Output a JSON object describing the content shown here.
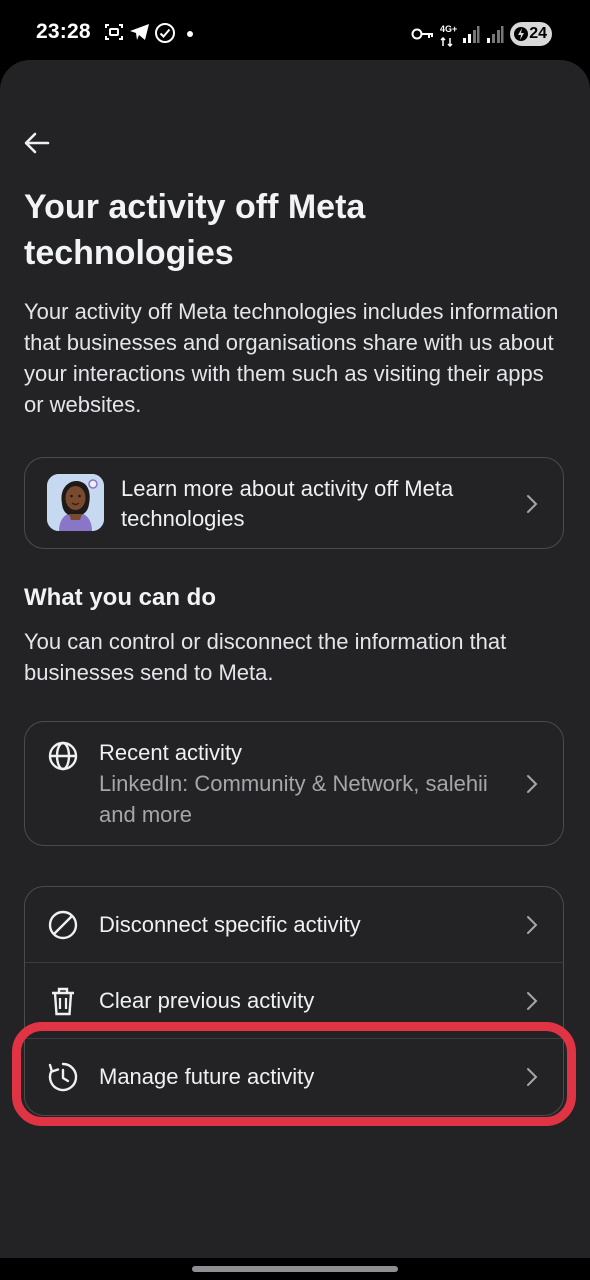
{
  "status_bar": {
    "time": "23:28",
    "network_label": "4G+",
    "battery": "24",
    "icons": [
      "screenshot-icon",
      "telegram-icon",
      "check-circle-icon",
      "dot-icon",
      "key-icon",
      "network-4g-icon",
      "signal-icon",
      "signal-icon-2",
      "battery-icon"
    ]
  },
  "header": {
    "back_icon": "arrow-left-icon",
    "title": "Your activity off Meta technologies",
    "description": "Your activity off Meta technologies includes information that businesses and organisations share with us about your interactions with them such as visiting their apps or websites."
  },
  "learn_more": {
    "label": "Learn more about activity off Meta technologies",
    "icon": "avatar-illustration"
  },
  "section": {
    "heading": "What you can do",
    "text": "You can control or disconnect the information that businesses send to Meta."
  },
  "recent_activity": {
    "title": "Recent activity",
    "subtitle": "LinkedIn: Community & Network, salehii and more",
    "icon": "globe-icon"
  },
  "actions": [
    {
      "label": "Disconnect specific activity",
      "icon": "disconnect-icon"
    },
    {
      "label": "Clear previous activity",
      "icon": "trash-icon"
    },
    {
      "label": "Manage future activity",
      "icon": "clock-history-icon"
    }
  ],
  "colors": {
    "background": "#232325",
    "highlight": "#e03444",
    "text": "#eef0f2",
    "muted": "#a4a6ab"
  }
}
